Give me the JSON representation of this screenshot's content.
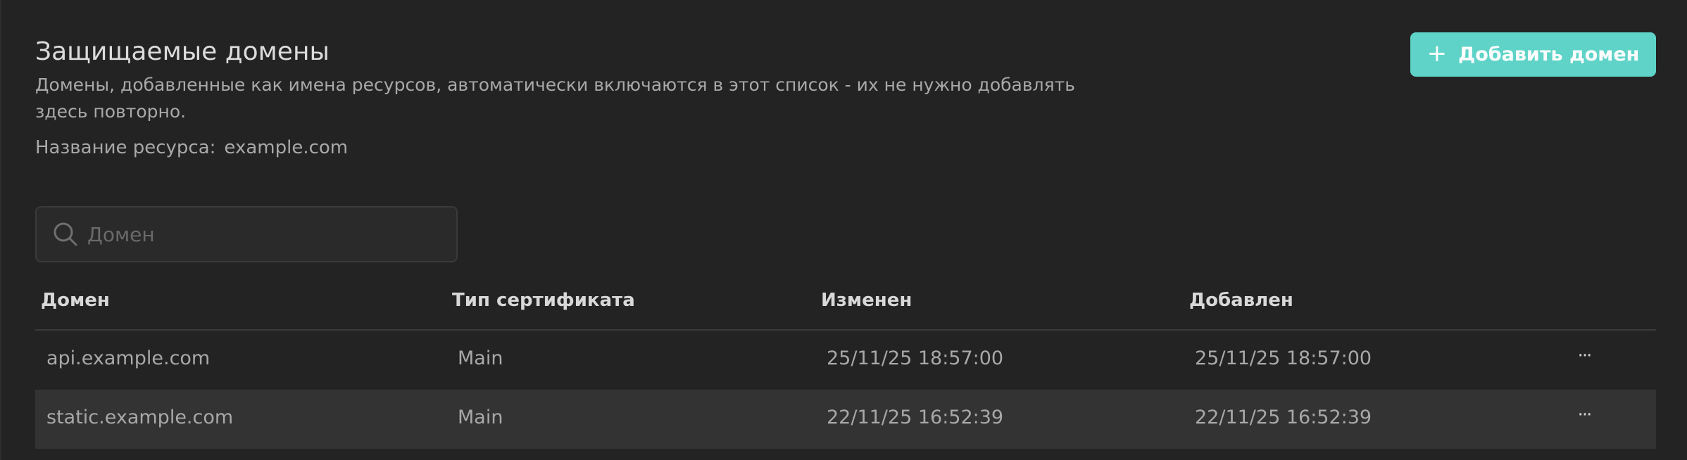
{
  "header": {
    "title": "Защищаемые домены",
    "subtitle": "Домены, добавленные как имена ресурсов, автоматически включаются в этот список - их не нужно добавлять здесь повторно.",
    "resource_label": "Название ресурса:",
    "resource_value": "example.com"
  },
  "actions": {
    "add_button_label": "Добавить домен",
    "add_icon": "plus-icon"
  },
  "search": {
    "placeholder": "Домен",
    "value": "",
    "icon": "search-icon"
  },
  "table": {
    "columns": [
      "Домен",
      "Тип сертификата",
      "Изменен",
      "Добавлен"
    ],
    "rows": [
      {
        "domain": "api.example.com",
        "cert_type": "Main",
        "modified": "25/11/25 18:57:00",
        "added": "25/11/25 18:57:00",
        "actions": "···"
      },
      {
        "domain": "static.example.com",
        "cert_type": "Main",
        "modified": "22/11/25 16:52:39",
        "added": "22/11/25 16:52:39",
        "actions": "···"
      }
    ]
  },
  "colors": {
    "background": "#232323",
    "accent": "#5fd3c8",
    "row_highlight": "#333333"
  }
}
